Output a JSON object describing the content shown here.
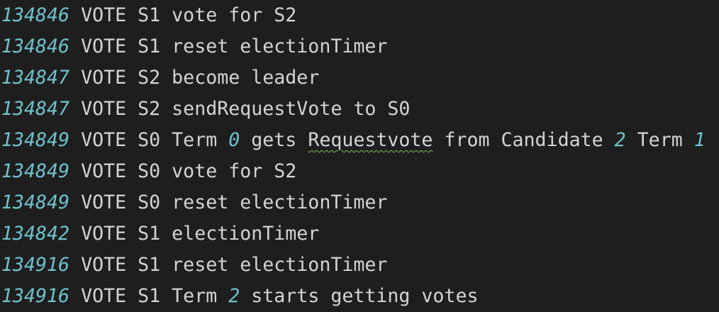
{
  "log": {
    "colors": {
      "background": "#1e1e1e",
      "text": "#d4d4d4",
      "timestamp": "#6fc1cc",
      "number": "#6fc1cc",
      "squiggle": "#7fbf4f"
    },
    "lines": [
      {
        "ts": "134846",
        "text": " VOTE S1 vote for S2"
      },
      {
        "ts": "134846",
        "text": " VOTE S1 reset electionTimer"
      },
      {
        "ts": "134847",
        "text": " VOTE S2 become leader"
      },
      {
        "ts": "134847",
        "text": " VOTE S2 sendRequestVote to S0"
      },
      {
        "ts": "134849",
        "t1": " VOTE S0 Term ",
        "n1": "0",
        "t2": " gets ",
        "warn": "Requestvote",
        "t3": " from Candidate ",
        "n2": "2",
        "t4": " Term ",
        "n3": "1"
      },
      {
        "ts": "134849",
        "text": " VOTE S0 vote for S2"
      },
      {
        "ts": "134849",
        "text": " VOTE S0 reset electionTimer"
      },
      {
        "ts": "134842",
        "text": " VOTE S1 electionTimer"
      },
      {
        "ts": "134916",
        "text": " VOTE S1 reset electionTimer"
      },
      {
        "ts": "134916",
        "t1": " VOTE S1 Term ",
        "n1": "2",
        "t2": " starts getting votes"
      }
    ]
  }
}
